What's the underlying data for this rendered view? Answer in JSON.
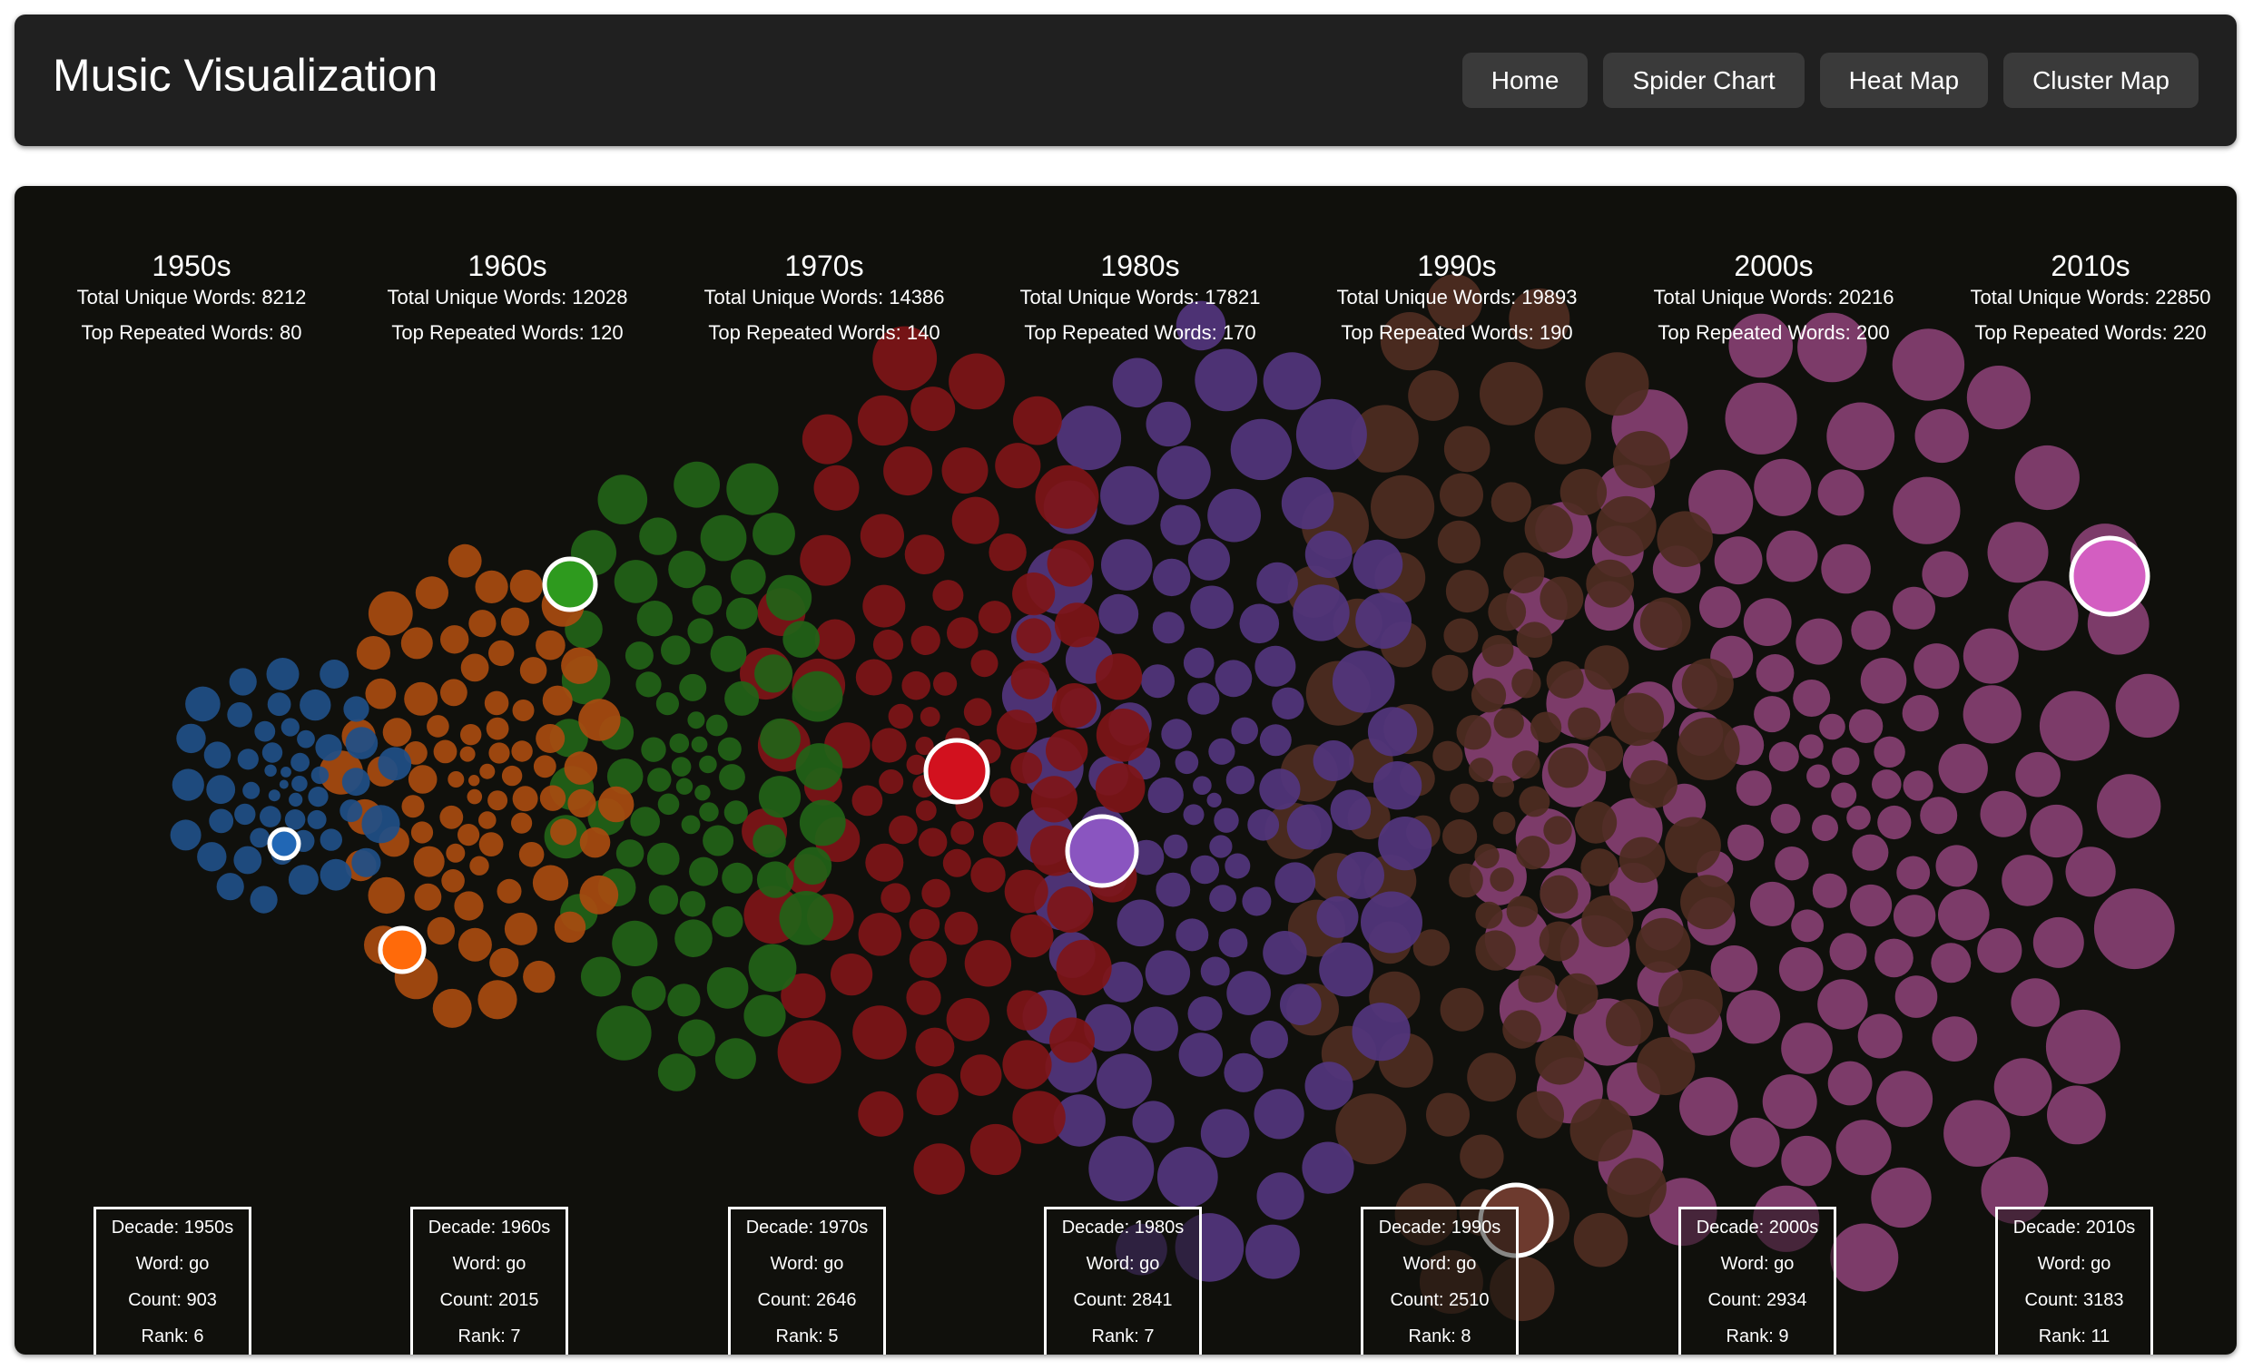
{
  "header": {
    "title": "Music Visualization",
    "nav": [
      "Home",
      "Spider Chart",
      "Heat Map",
      "Cluster Map"
    ]
  },
  "labels": {
    "unique_prefix": "Total Unique Words: ",
    "top_prefix": "Top Repeated Words: ",
    "decade_prefix": "Decade: ",
    "word_prefix": "Word: ",
    "count_prefix": "Count: ",
    "rank_prefix": "Rank: "
  },
  "decades": [
    {
      "name": "1950s",
      "unique_words": 8212,
      "top_repeated": 80,
      "color": "#1f4f88",
      "highlight_color": "#2167b5",
      "word": "go",
      "count": 903,
      "rank": 6
    },
    {
      "name": "1960s",
      "unique_words": 12028,
      "top_repeated": 120,
      "color": "#a84b10",
      "highlight_color": "#ff6a0a",
      "word": "go",
      "count": 2015,
      "rank": 7
    },
    {
      "name": "1970s",
      "unique_words": 14386,
      "top_repeated": 140,
      "color": "#226318",
      "highlight_color": "#2e9a1e",
      "word": "go",
      "count": 2646,
      "rank": 5
    },
    {
      "name": "1980s",
      "unique_words": 17821,
      "top_repeated": 170,
      "color": "#7e1518",
      "highlight_color": "#d2111e",
      "word": "go",
      "count": 2841,
      "rank": 7
    },
    {
      "name": "1990s",
      "unique_words": 19893,
      "top_repeated": 190,
      "color": "#52357e",
      "highlight_color": "#8a55c0",
      "word": "go",
      "count": 2510,
      "rank": 8
    },
    {
      "name": "2000s",
      "unique_words": 20216,
      "top_repeated": 200,
      "color": "#4e2c22",
      "highlight_color": "#6d3a2e",
      "word": "go",
      "count": 2934,
      "rank": 9
    },
    {
      "name": "2010s",
      "unique_words": 22850,
      "top_repeated": 220,
      "color": "#853f72",
      "highlight_color": "#d35ec1",
      "word": "go",
      "count": 3183,
      "rank": 11
    }
  ]
}
